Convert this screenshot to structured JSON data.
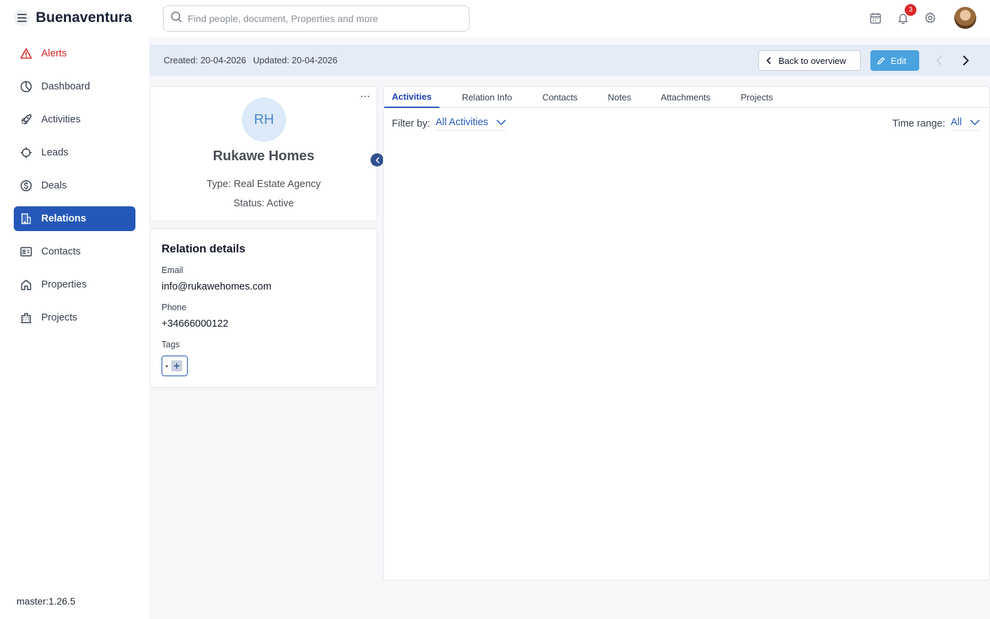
{
  "app": {
    "title": "Buenaventura"
  },
  "sidebar": {
    "items": [
      {
        "label": "Alerts",
        "icon": "alert-triangle-icon"
      },
      {
        "label": "Dashboard",
        "icon": "pie-chart-icon"
      },
      {
        "label": "Activities",
        "icon": "rocket-icon"
      },
      {
        "label": "Leads",
        "icon": "target-icon"
      },
      {
        "label": "Deals",
        "icon": "dollar-circle-icon"
      },
      {
        "label": "Relations",
        "icon": "building-icon"
      },
      {
        "label": "Contacts",
        "icon": "contact-card-icon"
      },
      {
        "label": "Properties",
        "icon": "home-icon"
      },
      {
        "label": "Projects",
        "icon": "city-icon"
      }
    ],
    "active": "Relations",
    "version": "master:1.26.5"
  },
  "search": {
    "placeholder": "Find people, document, Properties and more"
  },
  "topbar": {
    "notification_count": "3"
  },
  "infobar": {
    "created": "Created: 20-04-2026",
    "updated": "Updated: 20-04-2026",
    "back_label": "Back to overview",
    "edit_label": "Edit"
  },
  "profile": {
    "initials": "RH",
    "name": "Rukawe Homes",
    "type": "Type: Real Estate Agency",
    "status": "Status: Active",
    "more": "..."
  },
  "details": {
    "heading": "Relation details",
    "email_label": "Email",
    "email": "info@rukawehomes.com",
    "phone_label": "Phone",
    "phone": "+34666000122",
    "tags_label": "Tags"
  },
  "tabs": [
    {
      "label": "Activities"
    },
    {
      "label": "Relation Info"
    },
    {
      "label": "Contacts"
    },
    {
      "label": "Notes"
    },
    {
      "label": "Attachments"
    },
    {
      "label": "Projects"
    }
  ],
  "filter": {
    "label": "Filter by:",
    "value": "All Activities"
  },
  "time_range": {
    "label": "Time range:",
    "value": "All"
  },
  "colors": {
    "accent": "#2458b8",
    "edit": "#4aa3df",
    "alert": "#dc2626"
  }
}
